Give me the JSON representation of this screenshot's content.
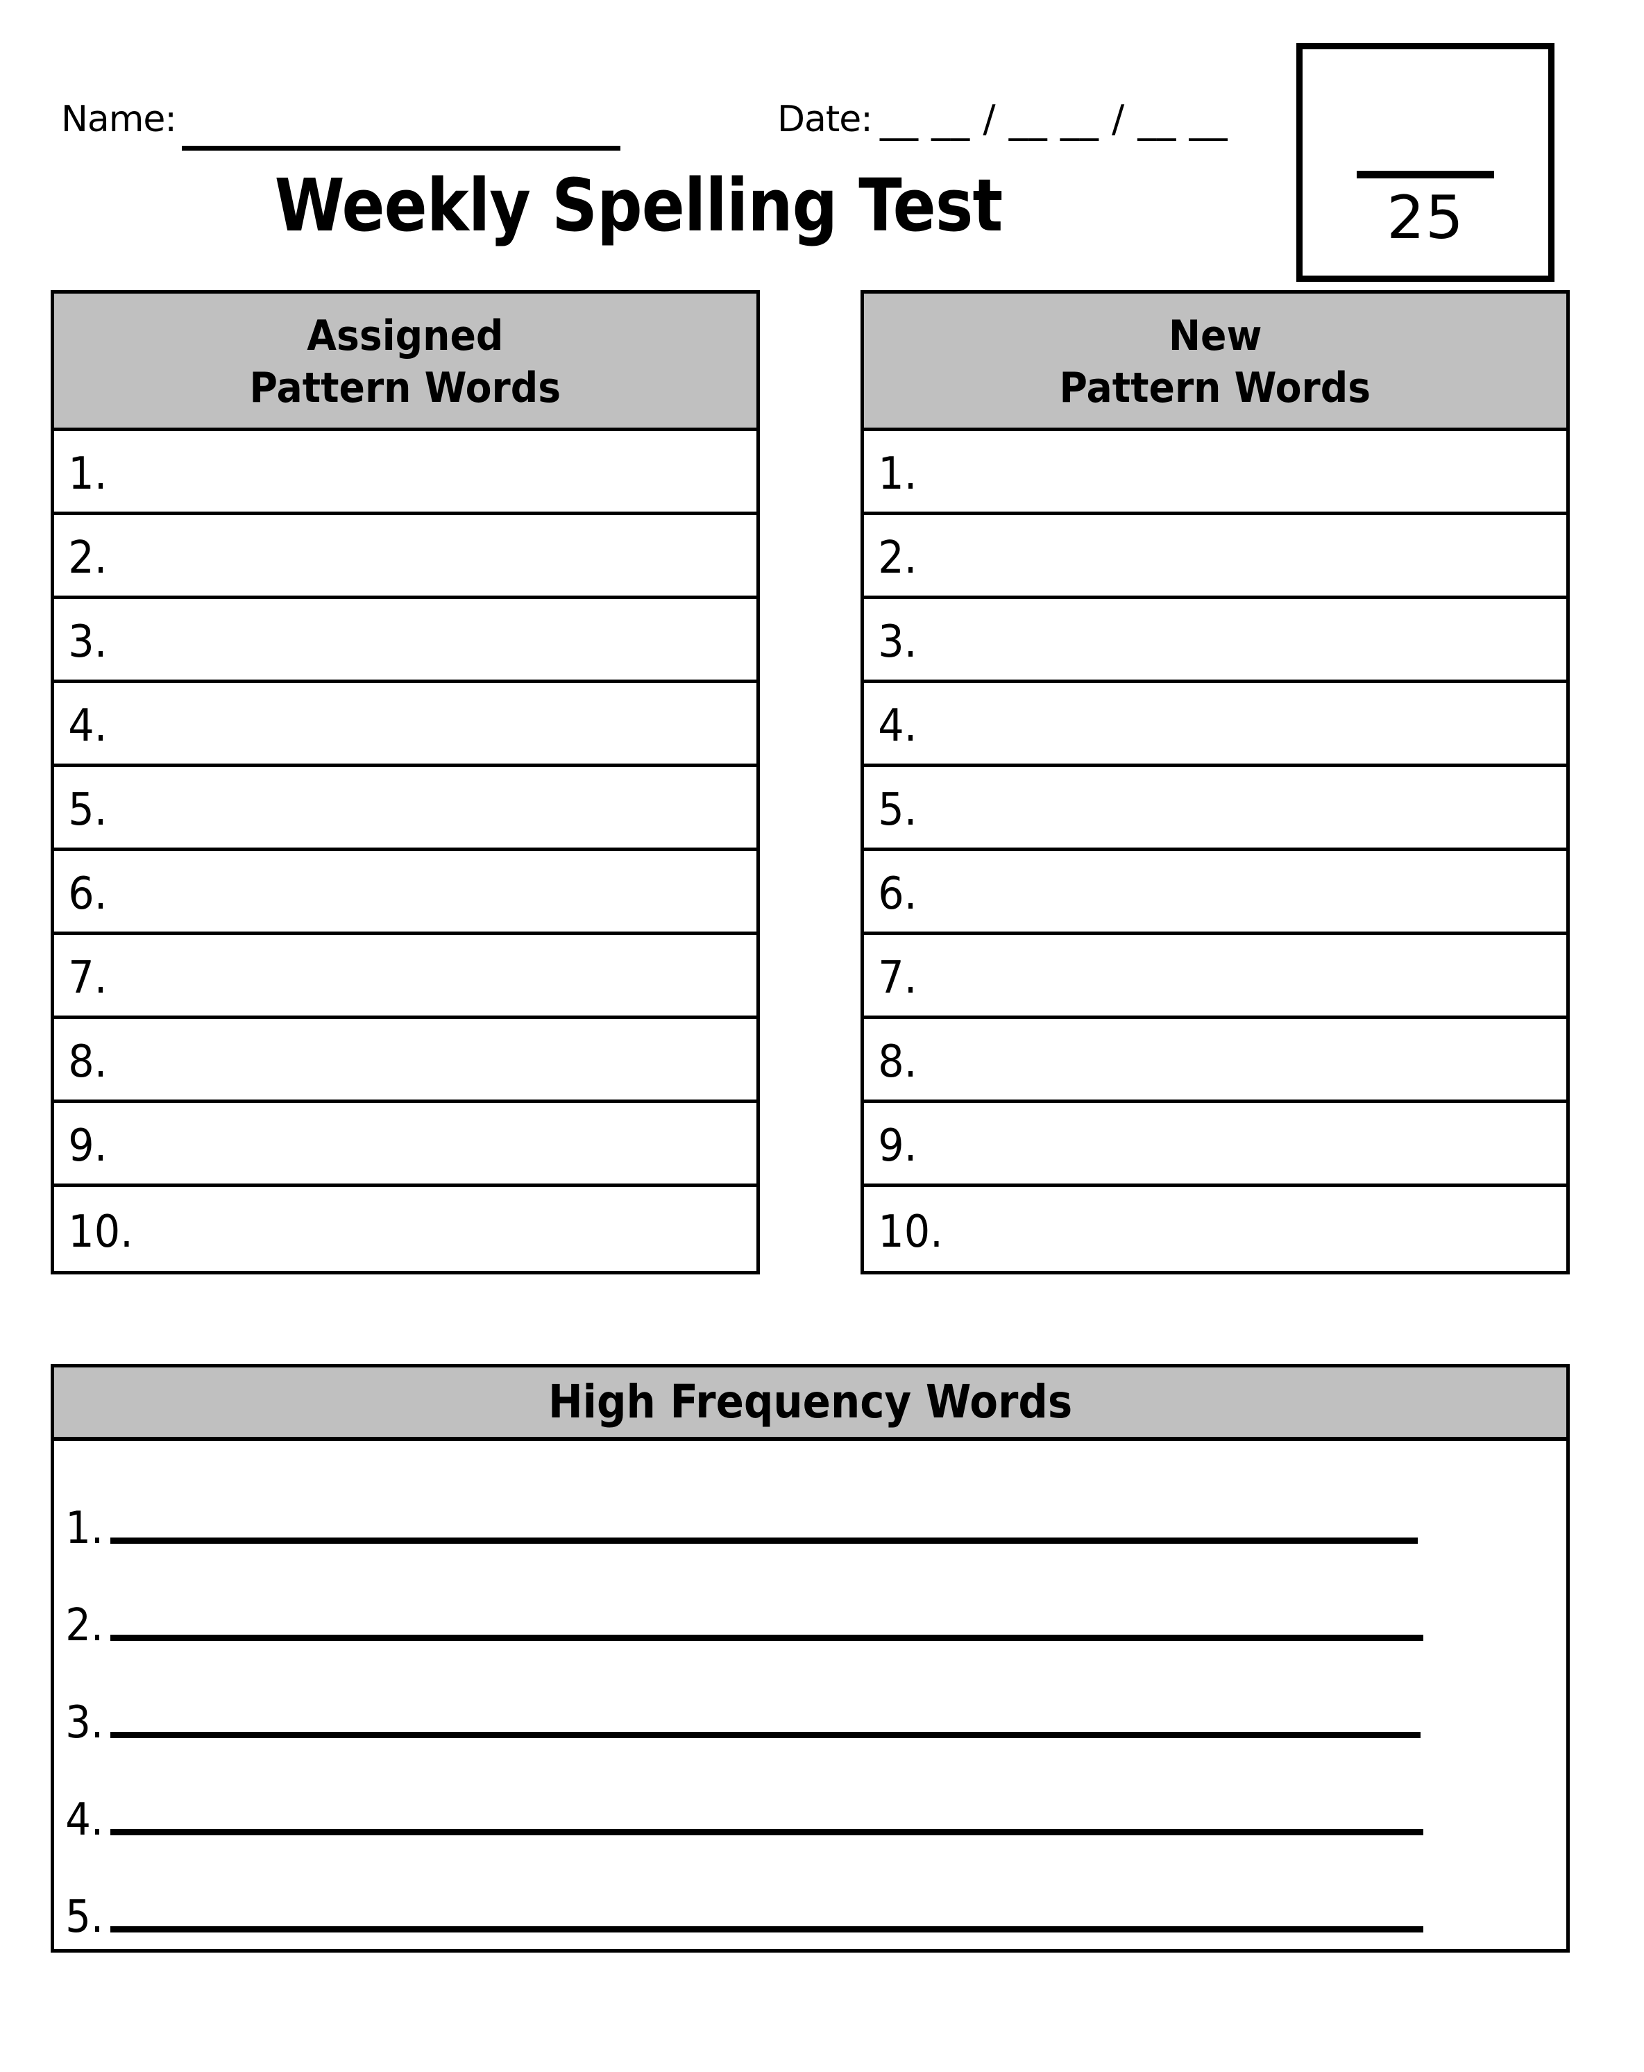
{
  "page": {
    "title": "Weekly Spelling Test",
    "background_color": "#FFFFFF",
    "ink_color": "#000000",
    "header_fill_color": "#C0C0C0"
  },
  "header": {
    "name_label": "Name:",
    "name_value": "",
    "name_placeholder": "",
    "date_label": "Date:",
    "date_blanks": "__ __ / __ __ / __ __",
    "date_value": ""
  },
  "score_box": {
    "earned_value": "",
    "divider": "fraction-bar",
    "total_possible": "25"
  },
  "tables": [
    {
      "id": "assigned-pattern-words",
      "header_line_1": "Assigned",
      "header_line_2": "Pattern Words",
      "rows": [
        {
          "number": "1.",
          "value": ""
        },
        {
          "number": "2.",
          "value": ""
        },
        {
          "number": "3.",
          "value": ""
        },
        {
          "number": "4.",
          "value": ""
        },
        {
          "number": "5.",
          "value": ""
        },
        {
          "number": "6.",
          "value": ""
        },
        {
          "number": "7.",
          "value": ""
        },
        {
          "number": "8.",
          "value": ""
        },
        {
          "number": "9.",
          "value": ""
        },
        {
          "number": "10.",
          "value": ""
        }
      ]
    },
    {
      "id": "new-pattern-words",
      "header_line_1": "New",
      "header_line_2": "Pattern Words",
      "rows": [
        {
          "number": "1.",
          "value": ""
        },
        {
          "number": "2.",
          "value": ""
        },
        {
          "number": "3.",
          "value": ""
        },
        {
          "number": "4.",
          "value": ""
        },
        {
          "number": "5.",
          "value": ""
        },
        {
          "number": "6.",
          "value": ""
        },
        {
          "number": "7.",
          "value": ""
        },
        {
          "number": "8.",
          "value": ""
        },
        {
          "number": "9.",
          "value": ""
        },
        {
          "number": "10.",
          "value": ""
        }
      ]
    }
  ],
  "high_frequency_words": {
    "header": "High Frequency Words",
    "rows": [
      {
        "number": "1.",
        "value": ""
      },
      {
        "number": "2.",
        "value": ""
      },
      {
        "number": "3.",
        "value": ""
      },
      {
        "number": "4.",
        "value": ""
      },
      {
        "number": "5.",
        "value": ""
      }
    ]
  }
}
